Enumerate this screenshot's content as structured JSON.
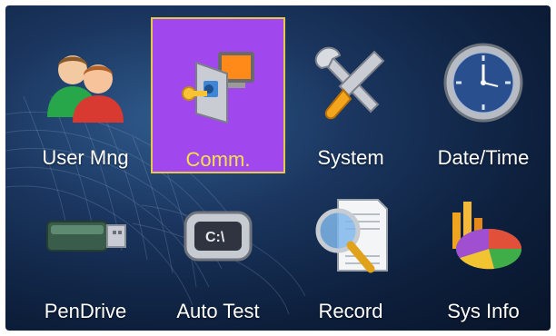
{
  "menu": {
    "items": [
      {
        "label": "User Mng",
        "icon": "users-icon",
        "selected": false
      },
      {
        "label": "Comm.",
        "icon": "communication-icon",
        "selected": true
      },
      {
        "label": "System",
        "icon": "tools-icon",
        "selected": false
      },
      {
        "label": "Date/Time",
        "icon": "clock-icon",
        "selected": false
      },
      {
        "label": "PenDrive",
        "icon": "usb-drive-icon",
        "selected": false
      },
      {
        "label": "Auto Test",
        "icon": "chip-test-icon",
        "selected": false
      },
      {
        "label": "Record",
        "icon": "magnifier-document-icon",
        "selected": false
      },
      {
        "label": "Sys Info",
        "icon": "pie-chart-icon",
        "selected": false
      }
    ]
  },
  "colors": {
    "selected_bg": "#a048ee",
    "selected_border": "#e6c84a",
    "selected_text": "#f5e14a",
    "label_text": "#ffffff",
    "background": "#1a355e"
  }
}
